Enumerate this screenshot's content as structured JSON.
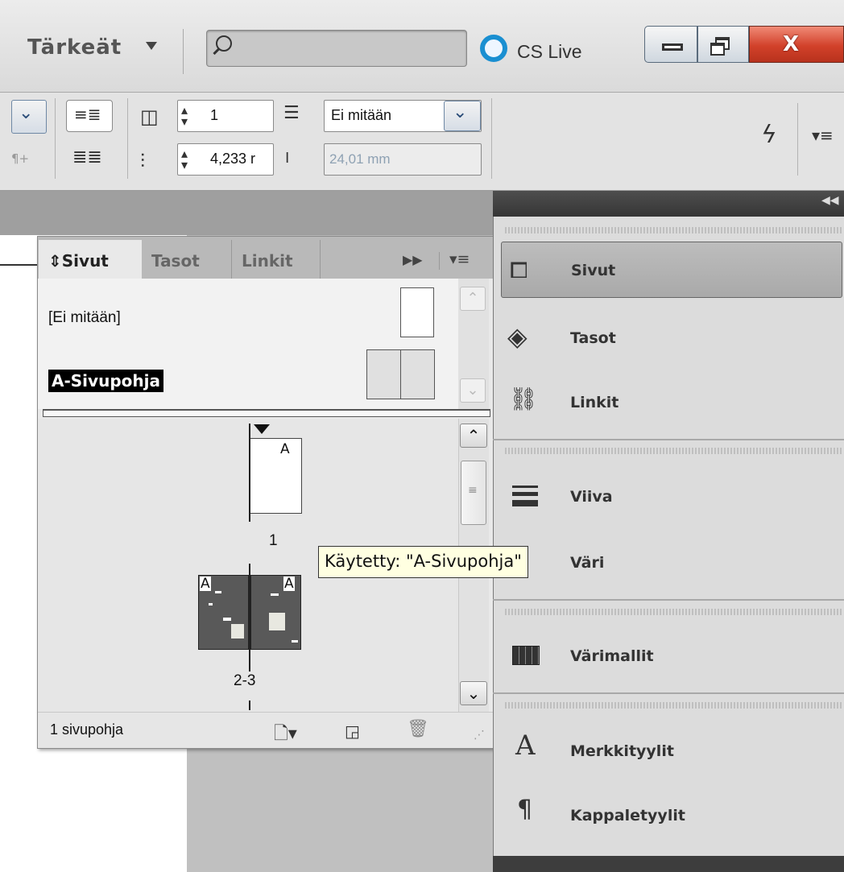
{
  "app_bar": {
    "workspace": "Tärkeät",
    "search_placeholder": "",
    "cslive_label": "CS Live",
    "close_label": "X"
  },
  "control_bar": {
    "columns_value": "1",
    "gutter_value": "4,233 r",
    "span_value": "Ei mitään",
    "width_value": "24,01 mm"
  },
  "pages_panel": {
    "tabs": [
      {
        "label": "Sivut"
      },
      {
        "label": "Tasot"
      },
      {
        "label": "Linkit"
      }
    ],
    "masters": [
      {
        "label": "[Ei mitään]"
      },
      {
        "label": "A-Sivupohja"
      }
    ],
    "pages": [
      {
        "number": "1",
        "prefix": "A"
      },
      {
        "number": "2-3",
        "prefix_left": "A",
        "prefix_right": "A"
      }
    ],
    "footer_count": "1 sivupohja"
  },
  "tooltip": "Käytetty: \"A-Sivupohja\"",
  "dock": {
    "items": [
      {
        "label": "Sivut",
        "icon": "pages-icon",
        "selected": true
      },
      {
        "label": "Tasot",
        "icon": "layers-icon"
      },
      {
        "label": "Linkit",
        "icon": "links-icon"
      },
      {
        "label": "Viiva",
        "icon": "stroke-icon"
      },
      {
        "label": "Väri",
        "icon": "color-icon"
      },
      {
        "label": "Värimallit",
        "icon": "swatches-icon"
      },
      {
        "label": "Merkkityylit",
        "icon": "character-styles-icon"
      },
      {
        "label": "Kappaletyylit",
        "icon": "paragraph-styles-icon"
      }
    ]
  },
  "colors": {
    "cslive_ring": "#1a8fd1",
    "close_button": "#d2412a",
    "tooltip_bg": "#ffffe1",
    "dock_header": "#363636"
  }
}
